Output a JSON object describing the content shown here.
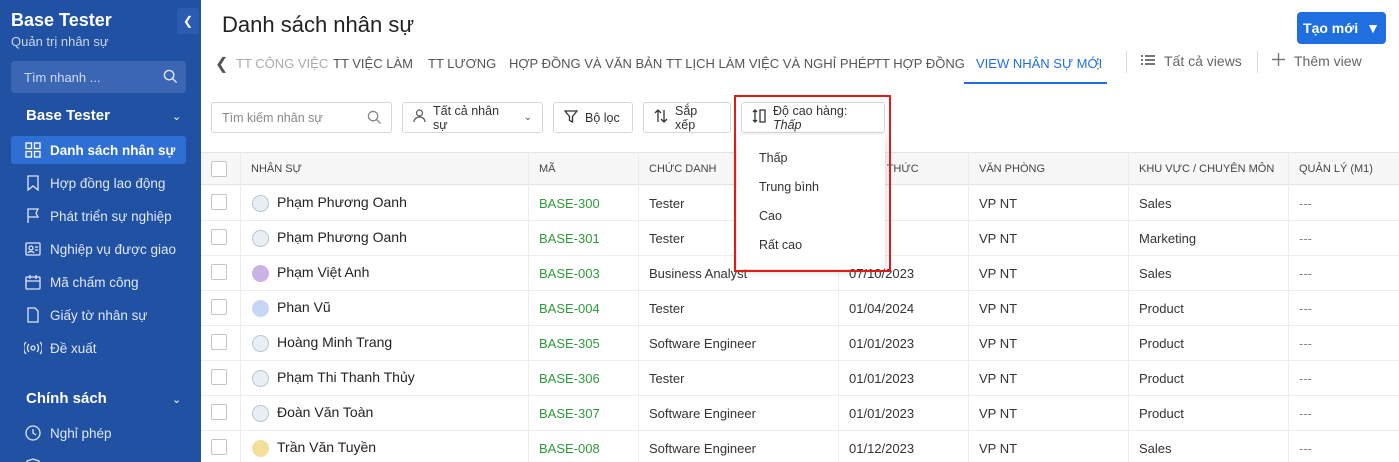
{
  "sidebar": {
    "brand_title": "Base Tester",
    "brand_sub": "Quản trị nhân sự",
    "search_placeholder": "Tìm nhanh ...",
    "group1": "Base Tester",
    "items": [
      {
        "label": "Danh sách nhân sự",
        "icon": "grid-icon",
        "active": true
      },
      {
        "label": "Hợp đồng lao động",
        "icon": "bookmark-icon"
      },
      {
        "label": "Phát triển sự nghiệp",
        "icon": "flag-icon"
      },
      {
        "label": "Nghiệp vụ được giao",
        "icon": "user-list-icon"
      },
      {
        "label": "Mã chấm công",
        "icon": "calendar-icon"
      },
      {
        "label": "Giấy tờ nhân sự",
        "icon": "document-icon"
      },
      {
        "label": "Đề xuất",
        "icon": "broadcast-icon"
      }
    ],
    "group2": "Chính sách",
    "items2": [
      {
        "label": "Nghỉ phép",
        "icon": "clock-icon"
      }
    ]
  },
  "header": {
    "title": "Danh sách nhân sự",
    "create_label": "Tạo mới"
  },
  "tabs": [
    {
      "label": "TT CÔNG VIỆC"
    },
    {
      "label": "TT VIỆC LÀM"
    },
    {
      "label": "TT LƯƠNG"
    },
    {
      "label": "HỢP ĐỒNG VÀ VĂN BẢN"
    },
    {
      "label": "TT LỊCH LÀM VIỆC VÀ NGHỈ PHÉP"
    },
    {
      "label": "TT HỢP ĐỒNG"
    },
    {
      "label": "VIEW NHÂN SỰ MỚI"
    }
  ],
  "views": {
    "all": "Tất cả views",
    "add": "Thêm view"
  },
  "toolbar": {
    "search_placeholder": "Tìm kiếm nhân sự",
    "all_staff": "Tất cả nhân sự",
    "filter": "Bộ lọc",
    "sort": "Sắp xếp",
    "row_height_label": "Độ cao hàng:",
    "row_height_value": "Thấp"
  },
  "row_height_options": [
    "Thấp",
    "Trung bình",
    "Cao",
    "Rất cao"
  ],
  "columns": [
    "NHÂN SỰ",
    "MÃ",
    "CHỨC DANH",
    "CHÍNH THỨC",
    "VĂN PHÒNG",
    "KHU VỰC / CHUYÊN MÔN",
    "QUẢN LÝ (M1)"
  ],
  "rows": [
    {
      "name": "Phạm Phương Oanh",
      "code": "BASE-300",
      "title": "Tester",
      "date": "/2023",
      "office": "VP NT",
      "area": "Sales",
      "manager": "---",
      "avatar": "img"
    },
    {
      "name": "Phạm Phương Oanh",
      "code": "BASE-301",
      "title": "Tester",
      "date": "/2023",
      "office": "VP NT",
      "area": "Marketing",
      "manager": "---",
      "avatar": "img"
    },
    {
      "name": "Phạm Việt Anh",
      "code": "BASE-003",
      "title": "Business Analyst",
      "date": "07/10/2023",
      "office": "VP NT",
      "area": "Sales",
      "manager": "---",
      "avatar": "purple"
    },
    {
      "name": "Phan Vũ",
      "code": "BASE-004",
      "title": "Tester",
      "date": "01/04/2024",
      "office": "VP NT",
      "area": "Product",
      "manager": "---",
      "avatar": "blue"
    },
    {
      "name": "Hoàng Minh Trang",
      "code": "BASE-305",
      "title": "Software Engineer",
      "date": "01/01/2023",
      "office": "VP NT",
      "area": "Product",
      "manager": "---",
      "avatar": "img"
    },
    {
      "name": "Phạm Thi Thanh Thủy",
      "code": "BASE-306",
      "title": "Tester",
      "date": "01/01/2023",
      "office": "VP NT",
      "area": "Product",
      "manager": "---",
      "avatar": "img"
    },
    {
      "name": "Đoàn Văn Toàn",
      "code": "BASE-307",
      "title": "Software Engineer",
      "date": "01/01/2023",
      "office": "VP NT",
      "area": "Product",
      "manager": "---",
      "avatar": "img"
    },
    {
      "name": "Trần Văn Tuyền",
      "code": "BASE-008",
      "title": "Software Engineer",
      "date": "01/12/2023",
      "office": "VP NT",
      "area": "Sales",
      "manager": "---",
      "avatar": "yellow"
    }
  ],
  "colors": {
    "sidebar_bg": "#2151a3",
    "accent": "#1f6fe0",
    "code_green": "#2e9a3a",
    "highlight_red": "#e01b1b"
  }
}
